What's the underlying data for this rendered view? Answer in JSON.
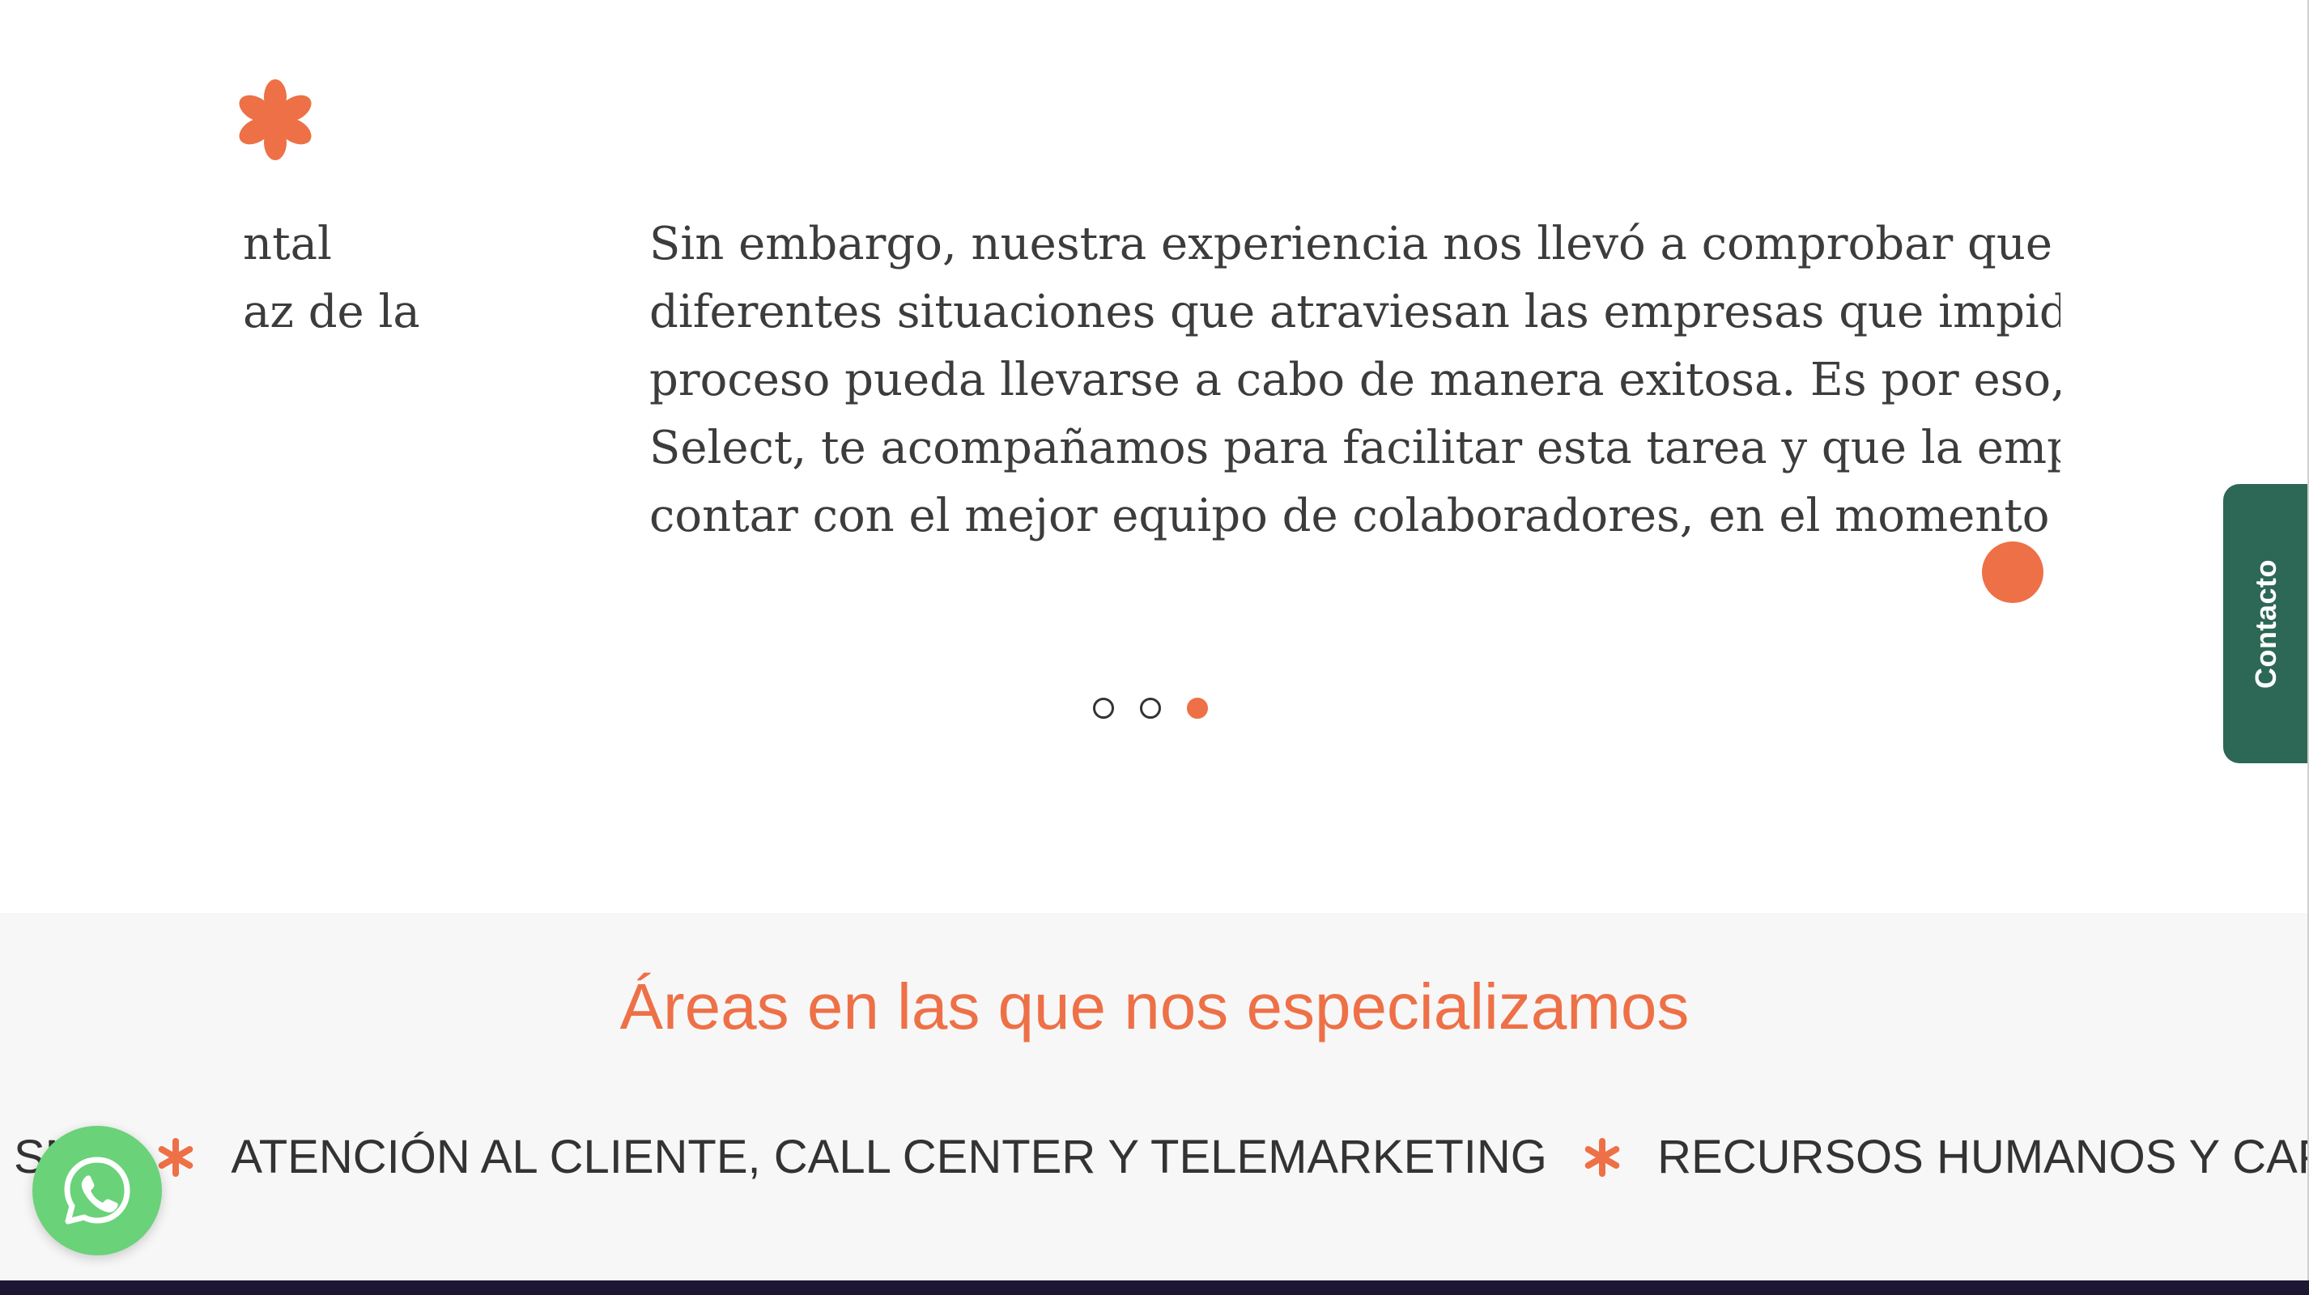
{
  "slider": {
    "prev_lines": [
      "",
      "ntal",
      "",
      "az de la",
      ""
    ],
    "current_lines": [
      "Sin embargo, nuestra experiencia nos llevó a comprobar que exist",
      "diferentes situaciones que atraviesan las empresas que impiden q",
      "proceso pueda llevarse a cabo de manera exitosa. Es por eso, que d",
      "Select, te acompañamos para facilitar esta tarea y que la empresa",
      "contar con el mejor equipo de colaboradores, en el momento indi"
    ],
    "pages": 3,
    "active_page": 3
  },
  "contact_tab": {
    "label": "Contacto"
  },
  "areas": {
    "title": "Áreas en las que nos especializamos",
    "items": [
      "SMO",
      "ATENCIÓN AL CLIENTE, CALL CENTER Y TELEMARKETING",
      "RECURSOS HUMANOS Y CAPACITACIÓN"
    ]
  },
  "colors": {
    "accent": "#ee7047",
    "contact_green": "#2c6855",
    "whatsapp_green": "#6ad279",
    "section_bg": "#f7f7f7"
  },
  "icons": [
    "asterisk-icon",
    "whatsapp-icon"
  ]
}
